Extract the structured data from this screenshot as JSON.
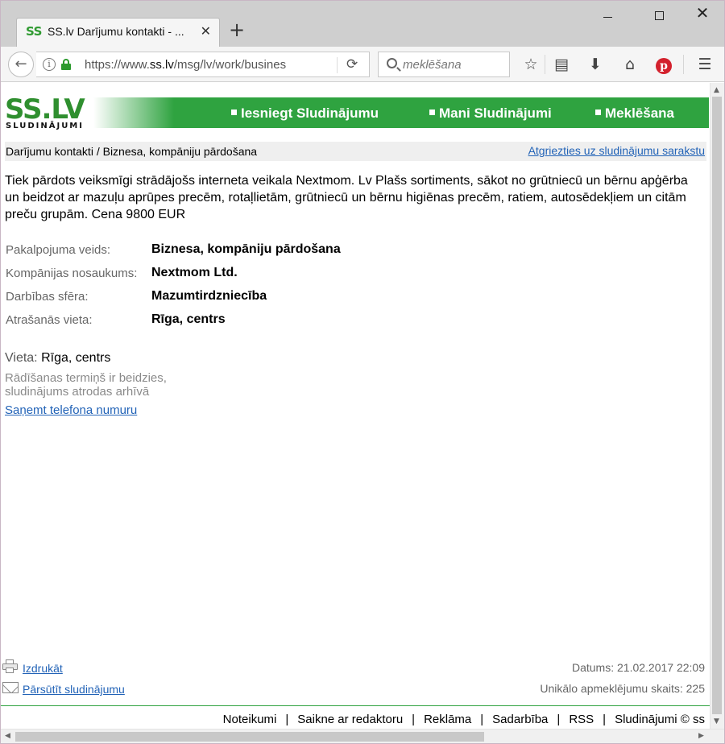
{
  "browser": {
    "tab_favicon": "SS",
    "tab_title": "SS.lv Darījumu kontakti - ...",
    "tab_close": "✕",
    "new_tab": "+",
    "url_prefix": "https://www.",
    "url_host": "ss.lv",
    "url_path": "/msg/lv/work/busines",
    "search_placeholder": "meklēšana",
    "icons": [
      "info-icon",
      "lock-icon",
      "reload-icon",
      "search-icon",
      "star-icon",
      "reader-icon",
      "download-icon",
      "home-icon",
      "pinterest-icon",
      "menu-icon"
    ],
    "secure_color": "#2c9a2e"
  },
  "site": {
    "logo": "SS.LV",
    "logo_sub": "SLUDINĀJUMI",
    "brand_color": "#2fa340",
    "nav": [
      "Iesniegt Sludinājumu",
      "Mani Sludinājumi",
      "Meklēšana"
    ]
  },
  "breadcrumb": {
    "path": "Darījumu kontakti / Biznesa, kompāniju pārdošana",
    "back_link": "Atgriezties uz sludinājumu sarakstu"
  },
  "ad": {
    "description": "Tiek pārdots veiksmīgi strādājošs interneta veikala Nextmom. Lv Plašs sortiments, sākot no grūtniecū un bērnu apģērba un beidzot ar mazuļu aprūpes precēm, rotaļlietām, grūtniecū un bērnu higiēnas precēm, ratiem, autosēdekļiem un citām preču grupām. Cena 9800 EUR",
    "options": [
      {
        "label": "Pakalpojuma veids:",
        "value": "Biznesa, kompāniju pārdošana"
      },
      {
        "label": "Kompānijas nosaukums:",
        "value": "Nextmom Ltd."
      },
      {
        "label": "Darbības sfēra:",
        "value": "Mazumtirdzniecība"
      },
      {
        "label": "Atrašanās vieta:",
        "value": "Rīga, centrs"
      }
    ],
    "location_label": "Vieta:",
    "location_value": "Rīga, centrs",
    "expired_line1": "Rādīšanas termiņš ir beidzies,",
    "expired_line2": "sludinājums atrodas arhīvā",
    "phone_link": "Saņemt telefona numuru"
  },
  "actions": {
    "print": "Izdrukāt",
    "forward": "Pārsūtīt sludinājumu"
  },
  "meta": {
    "date": "Datums: 21.02.2017 22:09",
    "views": "Unikālo apmeklējumu skaits: 225"
  },
  "footer": {
    "links": [
      "Noteikumi",
      "Saikne ar redaktoru",
      "Reklāma",
      "Sadarbība",
      "RSS",
      "Sludinājumi © ss"
    ],
    "separator": "|"
  }
}
